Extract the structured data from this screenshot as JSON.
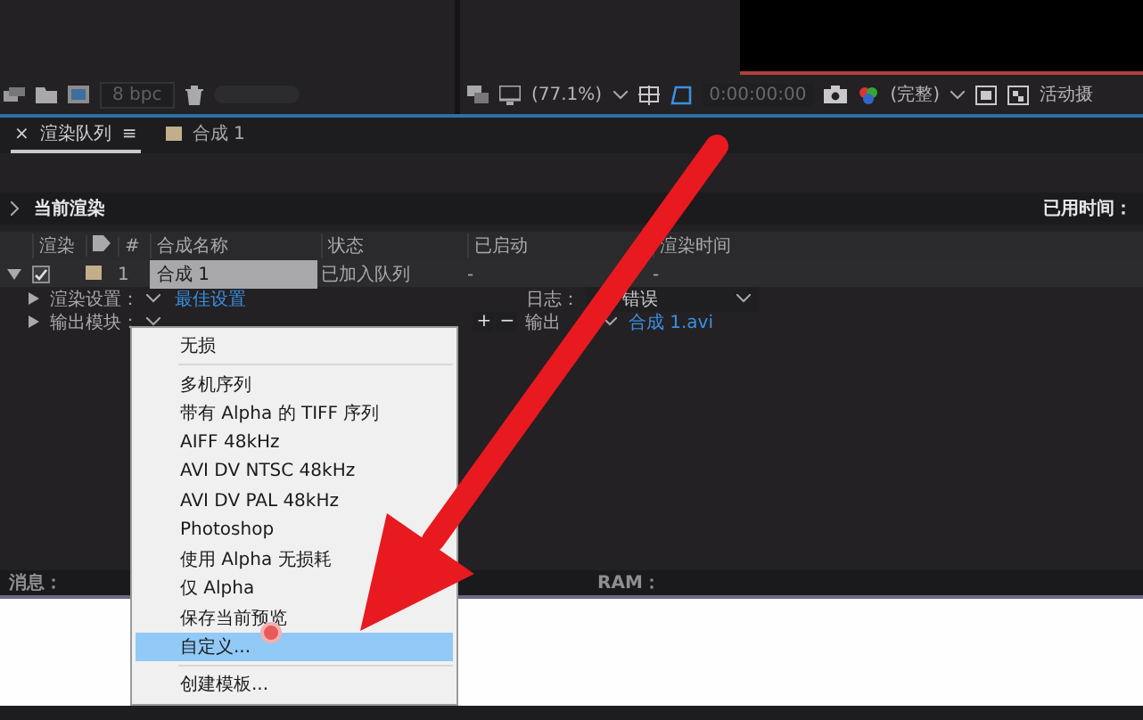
{
  "project_panel": {
    "bit_depth": "8 bpc"
  },
  "viewer_toolbar": {
    "zoom": "(77.1%)",
    "timecode": "0:00:00:00",
    "resolution": "(完整)",
    "camera": "活动摄"
  },
  "tabs": [
    {
      "close": "×",
      "label": "渲染队列",
      "menu": "≡",
      "selected": true
    },
    {
      "label": "合成 1",
      "color": "#c2ae8a",
      "selected": false
    }
  ],
  "render_queue": {
    "current_render": "当前渲染",
    "elapsed_label": "已用时间：",
    "columns": [
      "渲染",
      "#",
      "合成名称",
      "状态",
      "已启动",
      "渲染时间"
    ],
    "items": [
      {
        "expanded": true,
        "checked": true,
        "color": "#c2ae8a",
        "number": "1",
        "comp": "合成 1",
        "status": "已加入队列",
        "started": "-",
        "render_time": "-",
        "render_settings": {
          "label": "渲染设置：",
          "value": "最佳设置"
        },
        "log": {
          "label": "日志：",
          "value": "错误"
        },
        "output_module": {
          "label": "输出模块："
        },
        "add": "+",
        "remove": "−",
        "output_to": {
          "label": "输出",
          "value": "合成 1.avi"
        }
      }
    ]
  },
  "status_bar": {
    "message": "消息：",
    "ram": "RAM："
  },
  "menu": {
    "items": [
      {
        "kind": "item",
        "label": "无损",
        "selected": false
      },
      {
        "kind": "separator"
      },
      {
        "kind": "item",
        "label": "多机序列",
        "selected": false
      },
      {
        "kind": "item",
        "label": "带有 Alpha 的 TIFF 序列",
        "selected": false
      },
      {
        "kind": "item",
        "label": "AIFF 48kHz",
        "selected": false
      },
      {
        "kind": "item",
        "label": "AVI DV NTSC 48kHz",
        "selected": false
      },
      {
        "kind": "item",
        "label": "AVI DV PAL 48kHz",
        "selected": false
      },
      {
        "kind": "item",
        "label": "Photoshop",
        "selected": false
      },
      {
        "kind": "item",
        "label": "使用 Alpha 无损耗",
        "selected": false
      },
      {
        "kind": "item",
        "label": "仅 Alpha",
        "selected": false
      },
      {
        "kind": "item",
        "label": "保存当前预览",
        "selected": false
      },
      {
        "kind": "item",
        "label": "自定义...",
        "selected": true
      },
      {
        "kind": "separator"
      },
      {
        "kind": "item",
        "label": "创建模板...",
        "selected": false
      }
    ]
  }
}
